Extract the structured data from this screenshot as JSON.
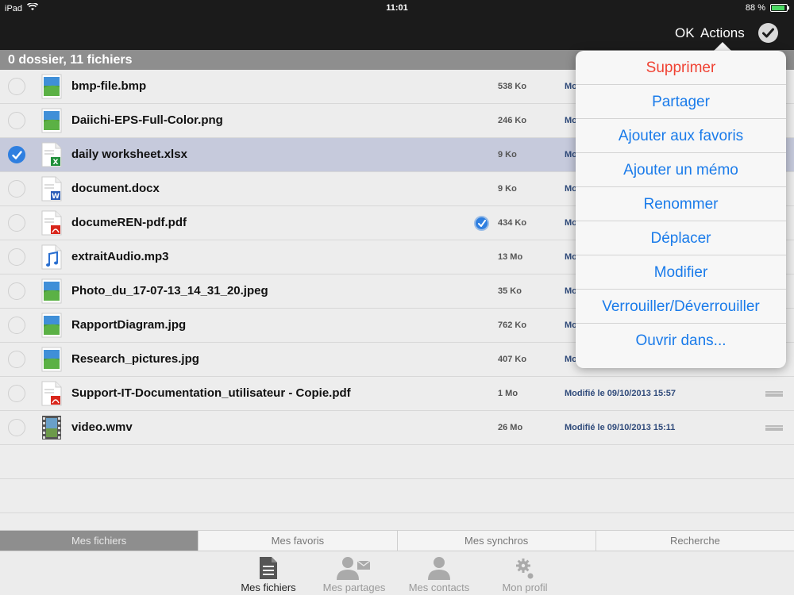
{
  "status": {
    "device": "iPad",
    "time": "11:01",
    "battery": "88 %",
    "battery_level": 0.88
  },
  "nav": {
    "ok": "OK",
    "actions": "Actions"
  },
  "header": {
    "summary": "0 dossier, 11 fichiers"
  },
  "files": [
    {
      "name": "bmp-file.bmp",
      "size": "538 Ko",
      "modified": "Mo",
      "icon": "image-icon",
      "selected": false,
      "synced": false
    },
    {
      "name": "Daiichi-EPS-Full-Color.png",
      "size": "246 Ko",
      "modified": "Mo",
      "icon": "image-icon",
      "selected": false,
      "synced": false
    },
    {
      "name": "daily worksheet.xlsx",
      "size": "9 Ko",
      "modified": "Mo",
      "icon": "excel-icon",
      "selected": true,
      "synced": false
    },
    {
      "name": "document.docx",
      "size": "9 Ko",
      "modified": "Mo",
      "icon": "word-icon",
      "selected": false,
      "synced": false
    },
    {
      "name": "documeREN-pdf.pdf",
      "size": "434 Ko",
      "modified": "Mo",
      "icon": "pdf-icon",
      "selected": false,
      "synced": true
    },
    {
      "name": "extraitAudio.mp3",
      "size": "13 Mo",
      "modified": "Mo",
      "icon": "audio-icon",
      "selected": false,
      "synced": false
    },
    {
      "name": "Photo_du_17-07-13_14_31_20.jpeg",
      "size": "35 Ko",
      "modified": "Mo",
      "icon": "image-icon",
      "selected": false,
      "synced": false
    },
    {
      "name": "RapportDiagram.jpg",
      "size": "762 Ko",
      "modified": "Mo",
      "icon": "image-icon",
      "selected": false,
      "synced": false
    },
    {
      "name": "Research_pictures.jpg",
      "size": "407 Ko",
      "modified": "Mo",
      "icon": "image-icon",
      "selected": false,
      "synced": false
    },
    {
      "name": "Support-IT-Documentation_utilisateur - Copie.pdf",
      "size": "1 Mo",
      "modified": "Modifié le 09/10/2013 15:57",
      "icon": "pdf-icon",
      "selected": false,
      "synced": false
    },
    {
      "name": "video.wmv",
      "size": "26 Mo",
      "modified": "Modifié le 09/10/2013 15:11",
      "icon": "video-icon",
      "selected": false,
      "synced": false
    }
  ],
  "actions_menu": [
    {
      "label": "Supprimer",
      "destructive": true
    },
    {
      "label": "Partager"
    },
    {
      "label": "Ajouter aux favoris"
    },
    {
      "label": "Ajouter un mémo"
    },
    {
      "label": "Renommer"
    },
    {
      "label": "Déplacer"
    },
    {
      "label": "Modifier"
    },
    {
      "label": "Verrouiller/Déverrouiller"
    },
    {
      "label": "Ouvrir dans..."
    }
  ],
  "segments": [
    "Mes fichiers",
    "Mes favoris",
    "Mes synchros",
    "Recherche"
  ],
  "tabs": [
    {
      "label": "Mes fichiers",
      "icon": "document-icon"
    },
    {
      "label": "Mes partages",
      "icon": "share-user-icon"
    },
    {
      "label": "Mes contacts",
      "icon": "contact-icon"
    },
    {
      "label": "Mon profil",
      "icon": "gear-icon"
    }
  ],
  "colors": {
    "accent": "#1a7bea",
    "destructive": "#f04233",
    "selected_row": "#c6cadc",
    "header": "#8e8e8e",
    "bar": "#1b1b1b"
  }
}
